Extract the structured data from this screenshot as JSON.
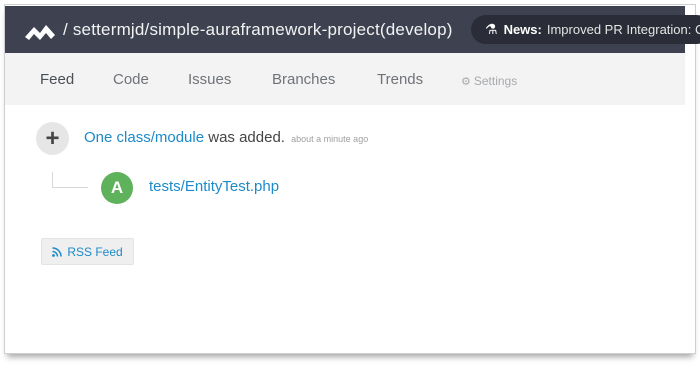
{
  "header": {
    "repo_path": "/ settermjd/simple-auraframework-project(develop)",
    "logo_icon": "codeclimate-logo-icon",
    "news": {
      "icon": "lab-flask-icon",
      "label": "News:",
      "text": "Improved PR Integration: Co"
    }
  },
  "nav": {
    "tabs": [
      {
        "label": "Feed",
        "active": true
      },
      {
        "label": "Code",
        "active": false
      },
      {
        "label": "Issues",
        "active": false
      },
      {
        "label": "Branches",
        "active": false
      },
      {
        "label": "Trends",
        "active": false
      }
    ],
    "settings_label": "Settings",
    "settings_icon": "gear-icon"
  },
  "feed": {
    "event_icon": "plus-icon",
    "event_link": "One class/module",
    "event_text": "was added.",
    "event_time": "about a minute ago",
    "item_badge": "A",
    "item_file": "tests/EntityTest.php",
    "rss_label": "RSS Feed",
    "rss_icon": "rss-icon"
  },
  "colors": {
    "topbar": "#3e4250",
    "link": "#1d8ac9",
    "added_badge": "#5fb25c"
  }
}
